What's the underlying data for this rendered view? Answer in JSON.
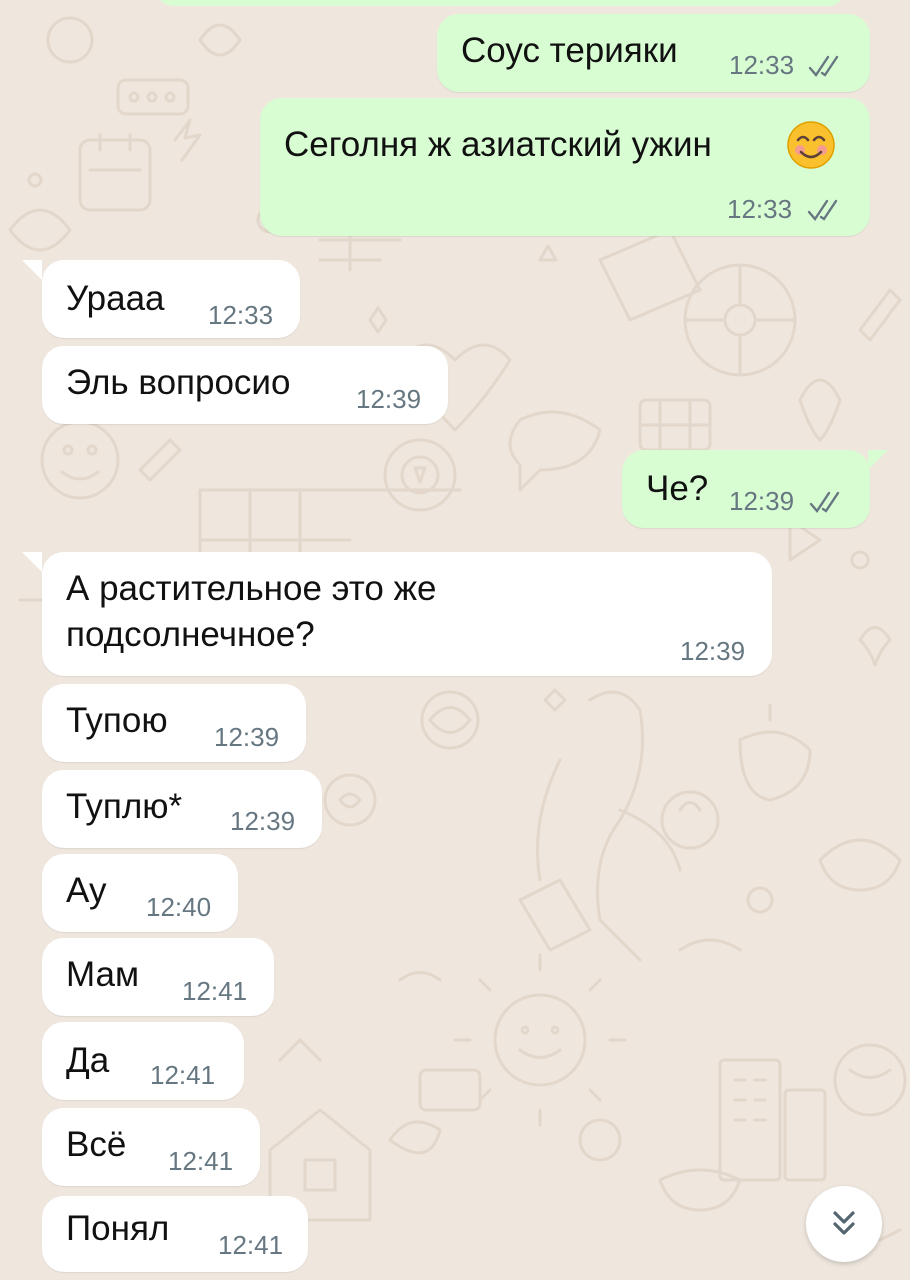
{
  "colors": {
    "background": "#efe7de",
    "incoming_bubble": "#ffffff",
    "outgoing_bubble": "#d9fdd3",
    "timestamp": "#667781",
    "doodle": "#e2d7ca"
  },
  "messages": [
    {
      "direction": "outgoing",
      "text": "Соус терияки",
      "time": "12:33",
      "status": "read",
      "status_icon": "double-check-icon"
    },
    {
      "direction": "outgoing",
      "text": "Сеголня ж азиатский ужин",
      "emoji": "smiling-face-emoji",
      "time": "12:33",
      "status": "read",
      "status_icon": "double-check-icon"
    },
    {
      "direction": "incoming",
      "text": "Урааа",
      "time": "12:33"
    },
    {
      "direction": "incoming",
      "text": "Эль вопросио",
      "time": "12:39"
    },
    {
      "direction": "outgoing",
      "text": "Че?",
      "time": "12:39",
      "status": "read",
      "status_icon": "double-check-icon"
    },
    {
      "direction": "incoming",
      "text_line1": "А растительное это же",
      "text_line2": "подсолнечное?",
      "time": "12:39"
    },
    {
      "direction": "incoming",
      "text": "Тупою",
      "time": "12:39"
    },
    {
      "direction": "incoming",
      "text": "Туплю*",
      "time": "12:39"
    },
    {
      "direction": "incoming",
      "text": "Ау",
      "time": "12:40"
    },
    {
      "direction": "incoming",
      "text": "Мам",
      "time": "12:41"
    },
    {
      "direction": "incoming",
      "text": "Да",
      "time": "12:41"
    },
    {
      "direction": "incoming",
      "text": "Всё",
      "time": "12:41"
    },
    {
      "direction": "incoming",
      "text": "Понял",
      "time": "12:41"
    }
  ],
  "scroll_button": {
    "icon": "double-chevron-down-icon"
  }
}
